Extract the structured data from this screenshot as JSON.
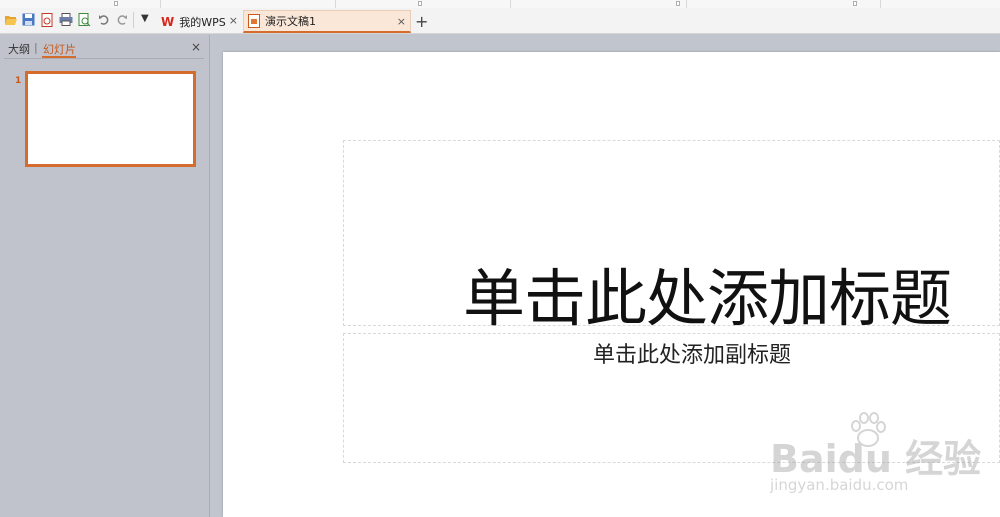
{
  "tabs": [
    {
      "label": "我的WPS",
      "close": "×"
    },
    {
      "label": "演示文稿1",
      "close": "×"
    }
  ],
  "tab_bar": {
    "new_tab": "+"
  },
  "panel": {
    "tab_outline": "大纲",
    "tab_divider": "|",
    "tab_slides": "幻灯片",
    "close": "×",
    "slide_number": "1"
  },
  "slide": {
    "title_placeholder": "单击此处添加标题",
    "subtitle_placeholder": "单击此处添加副标题"
  },
  "watermark": {
    "main": "Baidu 经验",
    "sub": "jingyan.baidu.com"
  },
  "colors": {
    "accent": "#d36c2c",
    "wps_red": "#d7271c",
    "panel_bg": "#c0c3cb"
  },
  "icons": [
    "open-icon",
    "save-icon",
    "export-pdf-icon",
    "print-icon",
    "print-preview-icon",
    "undo-icon",
    "redo-icon",
    "dropdown-icon"
  ]
}
